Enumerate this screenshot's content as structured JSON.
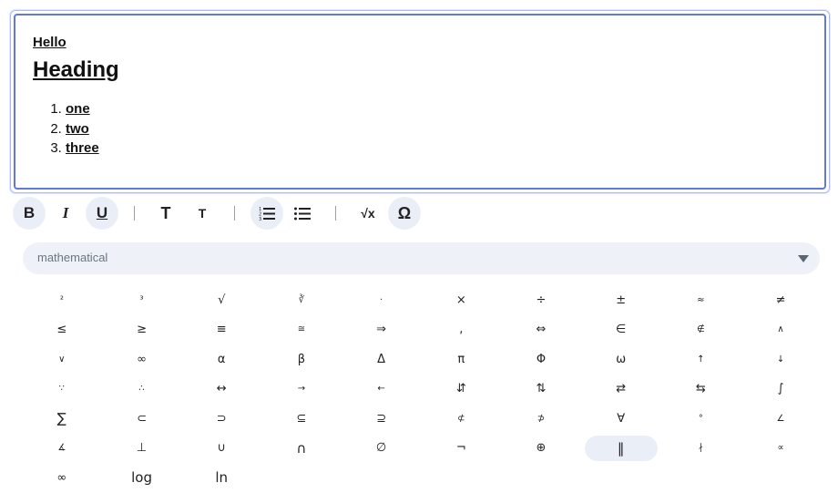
{
  "editor": {
    "paragraph": "Hello",
    "heading": "Heading",
    "list": [
      "one",
      "two",
      "three"
    ]
  },
  "toolbar": {
    "bold": "B",
    "italic": "I",
    "underline": "U",
    "font_larger": "T",
    "font_smaller": "T",
    "equation": "√x",
    "special_chars": "Ω"
  },
  "charset_select": {
    "value": "mathematical"
  },
  "symbols": [
    "²",
    "³",
    "√",
    "∛",
    "·",
    "×",
    "÷",
    "±",
    "≈",
    "≠",
    "≤",
    "≥",
    "≡",
    "≅",
    "⇒",
    ",",
    "⇔",
    "∈",
    "∉",
    "∧",
    "∨",
    "∞",
    "α",
    "β",
    "Δ",
    "π",
    "Φ",
    "ω",
    "↑",
    "↓",
    "∵",
    "∴",
    "↔",
    "→",
    "←",
    "⇵",
    "⇅",
    "⇄",
    "⇆",
    "∫",
    "∑",
    "⊂",
    "⊃",
    "⊆",
    "⊇",
    "⊄",
    "⊅",
    "∀",
    "°",
    "∠",
    "∡",
    "⊥",
    "∪",
    "∩",
    "∅",
    "¬",
    "⊕",
    "‖",
    "∤",
    "∝",
    "∞",
    "log",
    "ln"
  ],
  "selected_symbol_index": 57,
  "colors": {
    "accent": "#5f7ad9",
    "active_bg": "#eaeff7"
  }
}
